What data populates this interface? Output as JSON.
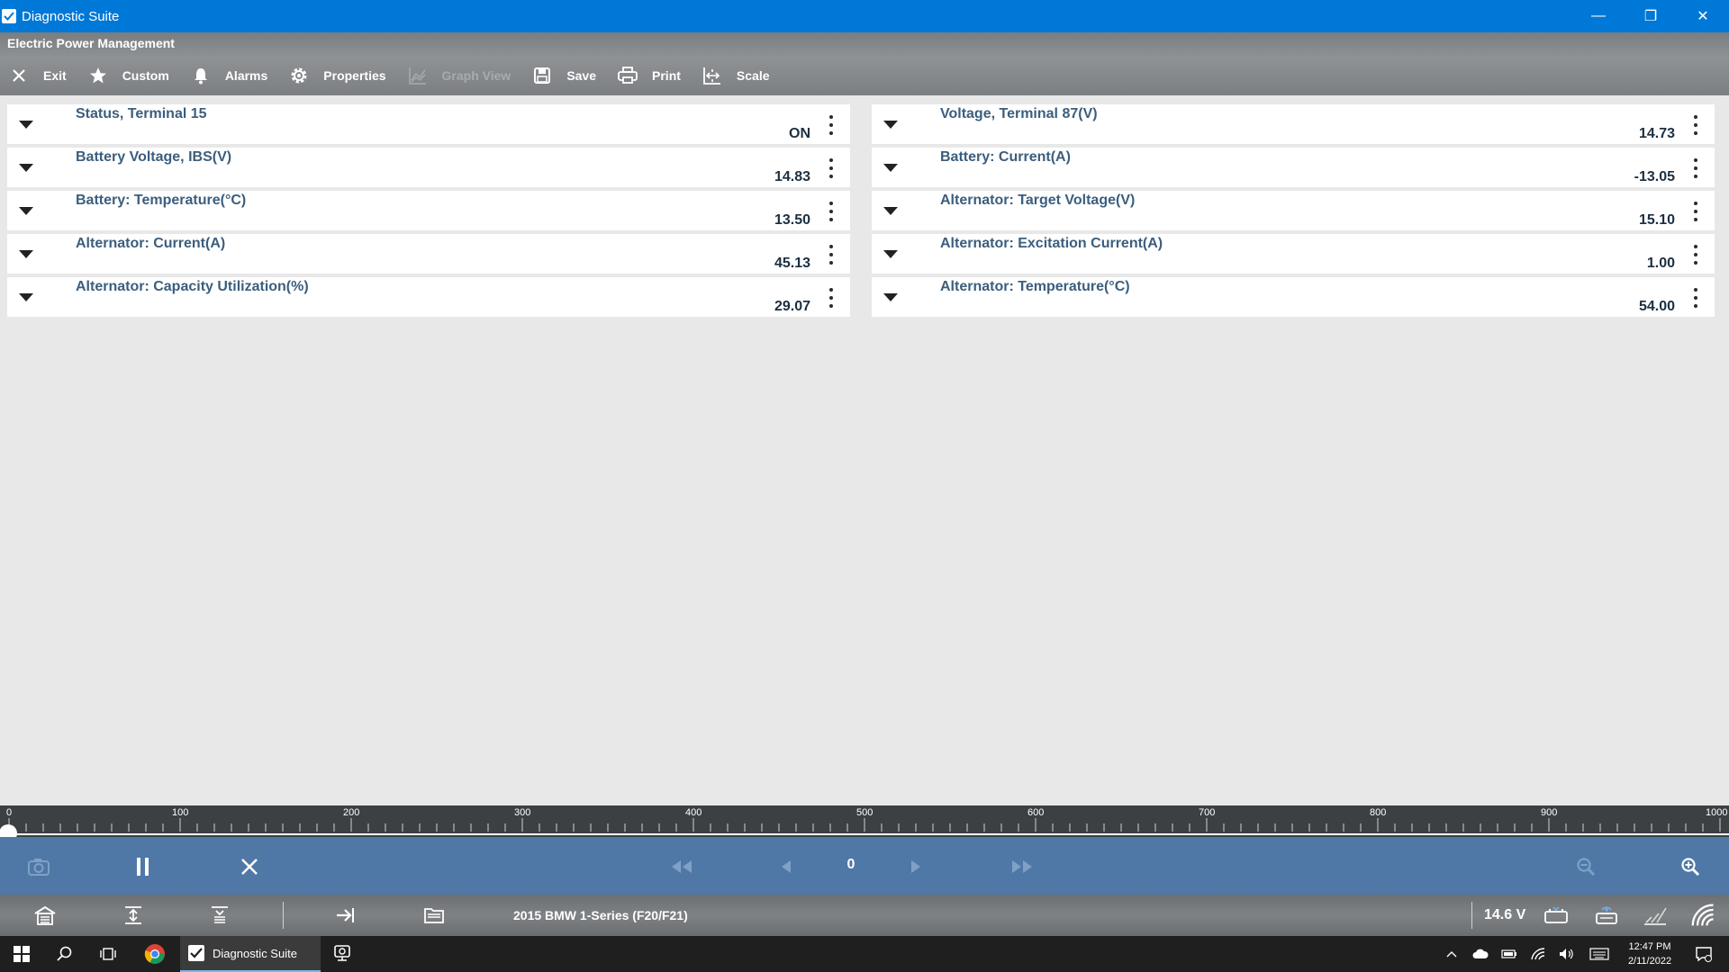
{
  "window": {
    "title": "Diagnostic Suite",
    "minimize_glyph": "—",
    "restore_glyph": "❐",
    "close_glyph": "✕"
  },
  "module": {
    "title": "Electric Power Management"
  },
  "toolbar": {
    "exit": "Exit",
    "custom": "Custom",
    "alarms": "Alarms",
    "properties": "Properties",
    "graph_view": "Graph View",
    "save": "Save",
    "print": "Print",
    "scale": "Scale"
  },
  "parameters": {
    "left": [
      {
        "label": "Status, Terminal 15",
        "value": "ON"
      },
      {
        "label": "Battery Voltage, IBS(V)",
        "value": "14.83"
      },
      {
        "label": "Battery: Temperature(°C)",
        "value": "13.50"
      },
      {
        "label": "Alternator: Current(A)",
        "value": "45.13"
      },
      {
        "label": "Alternator: Capacity Utilization(%)",
        "value": "29.07"
      }
    ],
    "right": [
      {
        "label": "Voltage, Terminal 87(V)",
        "value": "14.73"
      },
      {
        "label": "Battery: Current(A)",
        "value": "-13.05"
      },
      {
        "label": "Alternator: Target Voltage(V)",
        "value": "15.10"
      },
      {
        "label": "Alternator: Excitation Current(A)",
        "value": "1.00"
      },
      {
        "label": "Alternator: Temperature(°C)",
        "value": "54.00"
      }
    ]
  },
  "timeline": {
    "ticks": [
      "0",
      "100",
      "200",
      "300",
      "400",
      "500",
      "600",
      "700",
      "800",
      "900",
      "1000"
    ],
    "position": 0
  },
  "playback": {
    "frame": "0"
  },
  "status": {
    "vehicle": "2015 BMW 1-Series (F20/F21)",
    "voltage": "14.6 V"
  },
  "taskbar": {
    "app_label": "Diagnostic Suite",
    "time": "12:47 PM",
    "date": "2/11/2022"
  },
  "colors": {
    "titlebar": "#0078d7",
    "label": "#3b5e7e",
    "playback": "#4f78a6"
  }
}
